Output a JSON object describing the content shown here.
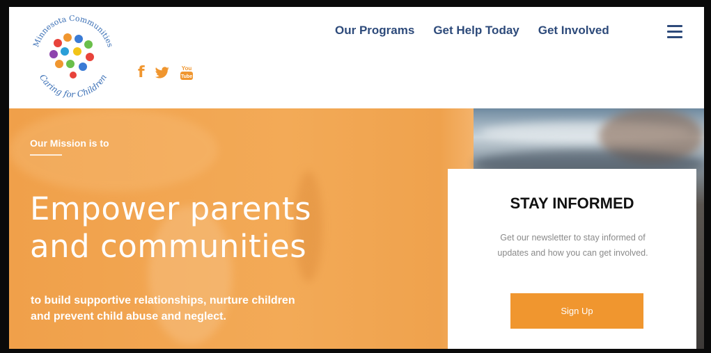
{
  "logo": {
    "arc_top": "Minnesota Communities",
    "arc_bottom": "Caring for Children"
  },
  "social": [
    {
      "icon": "facebook-icon",
      "glyph": "f"
    },
    {
      "icon": "twitter-icon",
      "glyph": "t"
    },
    {
      "icon": "youtube-icon",
      "glyph": "You Tube"
    }
  ],
  "nav": {
    "items": [
      "Our Programs",
      "Get Help Today",
      "Get Involved"
    ],
    "menu_icon": "hamburger-menu-icon"
  },
  "hero": {
    "label": "Our Mission is to",
    "headline_line1": "Empower parents",
    "headline_line2": "and communities",
    "subtext_line1": "to build supportive relationships, nurture children",
    "subtext_line2": "and prevent child abuse and neglect."
  },
  "card": {
    "title": "STAY INFORMED",
    "text_line1": "Get our newsletter to stay informed of",
    "text_line2": "updates and how you can get involved.",
    "button": "Sign Up"
  },
  "colors": {
    "accent": "#f0962f",
    "nav": "#2d4a7a"
  }
}
